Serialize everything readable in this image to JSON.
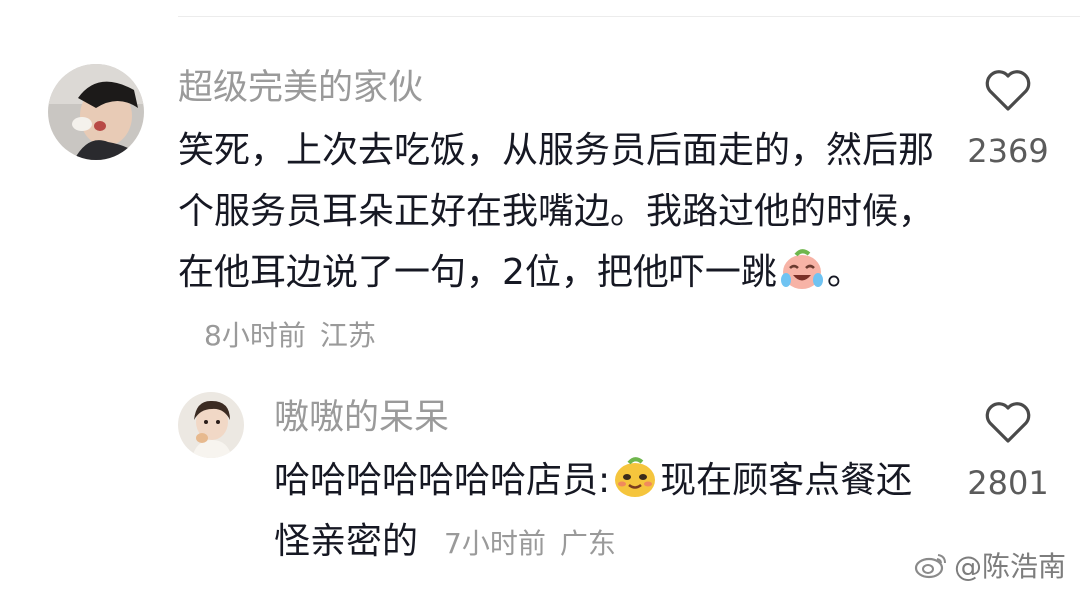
{
  "comment": {
    "username": "超级完美的家伙",
    "text": "笑死，上次去吃饭，从服务员后面走的，然后那个服务员耳朵正好在我嘴边。我路过他的时候，在他耳边说了一句，2位，把他吓一跳",
    "text_tail": "。",
    "emoji": "crying-laughing-face",
    "time": "8小时前",
    "location": "江苏",
    "like_count": "2369",
    "like_icon": "heart-outline-icon"
  },
  "reply": {
    "username": "嗷嗷的呆呆",
    "text": "哈哈哈哈哈哈哈店员:",
    "emoji": "smug-face",
    "text_tail": "现在顾客点餐还怪亲密的",
    "time": "7小时前",
    "location": "广东",
    "like_count": "2801",
    "like_icon": "heart-outline-icon"
  },
  "watermark": {
    "icon": "weibo-logo",
    "text": "@陈浩南"
  }
}
